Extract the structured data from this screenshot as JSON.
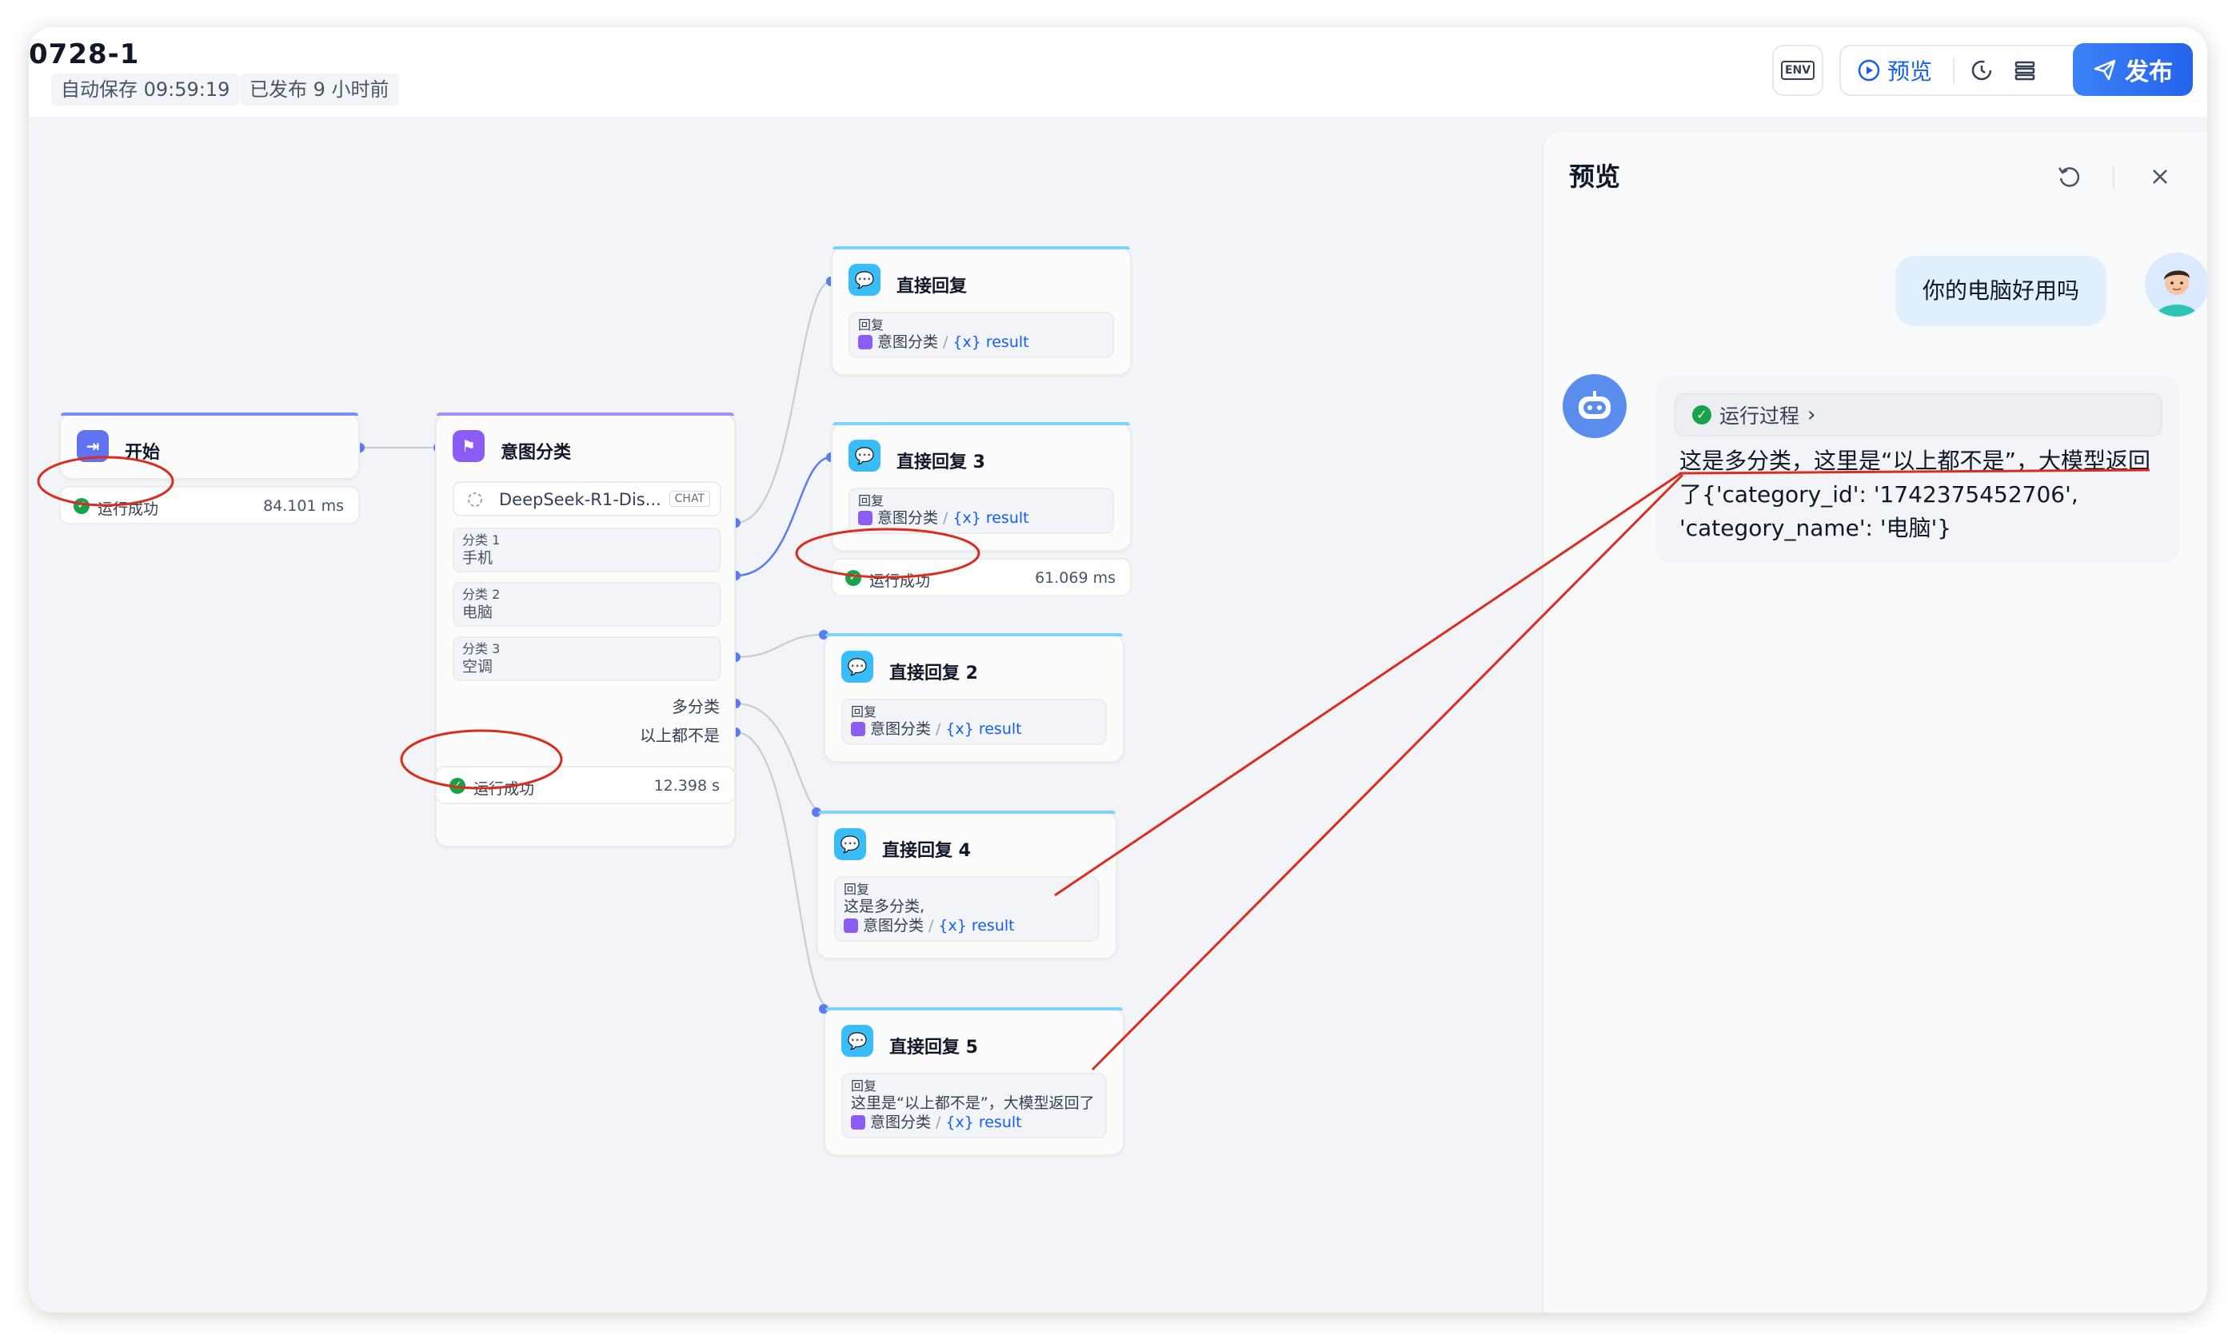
{
  "app": {
    "title": "0728-1",
    "autosave": "自动保存 09:59:19",
    "published": "已发布 9 小时前"
  },
  "toolbar": {
    "env_label": "ENV",
    "preview_label": "预览",
    "publish_label": "发布"
  },
  "nodes": {
    "start": {
      "title": "开始",
      "status": "运行成功",
      "time": "84.101 ms"
    },
    "intent": {
      "title": "意图分类",
      "model": "DeepSeek-R1-Dis...",
      "model_tag": "CHAT",
      "classes": [
        {
          "label": "分类 1",
          "value": "手机"
        },
        {
          "label": "分类 2",
          "value": "电脑"
        },
        {
          "label": "分类 3",
          "value": "空调"
        }
      ],
      "port_multi": "多分类",
      "port_none": "以上都不是",
      "status": "运行成功",
      "time": "12.398 s"
    },
    "reply1": {
      "title": "直接回复",
      "label": "回复",
      "var_node": "意图分类",
      "var_name": "result"
    },
    "reply3": {
      "title": "直接回复 3",
      "label": "回复",
      "var_node": "意图分类",
      "var_name": "result",
      "status": "运行成功",
      "time": "61.069 ms"
    },
    "reply2": {
      "title": "直接回复 2",
      "label": "回复",
      "var_node": "意图分类",
      "var_name": "result"
    },
    "reply4": {
      "title": "直接回复 4",
      "label": "回复",
      "text": "这是多分类,",
      "var_node": "意图分类",
      "var_name": "result"
    },
    "reply5": {
      "title": "直接回复 5",
      "label": "回复",
      "text": "这里是“以上都不是”，大模型返回了",
      "var_node": "意图分类",
      "var_name": "result"
    }
  },
  "preview": {
    "title": "预览",
    "user_message": "你的电脑好用吗",
    "run_process": "运行过程",
    "bot_message": "这是多分类，这里是“以上都不是”，大模型返回了{'category_id': '1742375452706', 'category_name': '电脑'}"
  },
  "colors": {
    "accent_blue": "#155eef",
    "publish_blue": "#2563eb",
    "success_green": "#16a34a",
    "annotation_red": "#d92d20",
    "edge_blue": "#5b7cf0"
  }
}
